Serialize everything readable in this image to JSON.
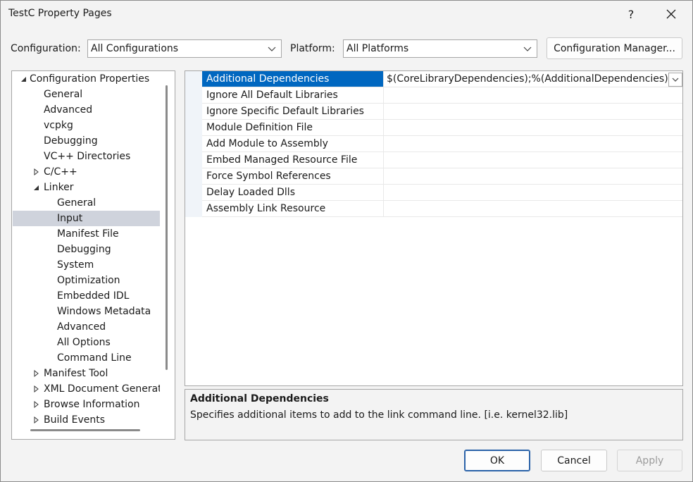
{
  "window": {
    "title": "TestC Property Pages",
    "help_label": "?",
    "close_label": "✕"
  },
  "toolbar": {
    "configuration_label": "Configuration:",
    "configuration_value": "All Configurations",
    "platform_label": "Platform:",
    "platform_value": "All Platforms",
    "config_manager_label": "Configuration Manager..."
  },
  "tree": {
    "items": [
      {
        "label": "Configuration Properties",
        "level": 0,
        "toggle": "expanded"
      },
      {
        "label": "General",
        "level": 1,
        "toggle": "none"
      },
      {
        "label": "Advanced",
        "level": 1,
        "toggle": "none"
      },
      {
        "label": "vcpkg",
        "level": 1,
        "toggle": "none"
      },
      {
        "label": "Debugging",
        "level": 1,
        "toggle": "none"
      },
      {
        "label": "VC++ Directories",
        "level": 1,
        "toggle": "none"
      },
      {
        "label": "C/C++",
        "level": 1,
        "toggle": "collapsed"
      },
      {
        "label": "Linker",
        "level": 1,
        "toggle": "expanded"
      },
      {
        "label": "General",
        "level": 2,
        "toggle": "none"
      },
      {
        "label": "Input",
        "level": 2,
        "toggle": "none",
        "selected": true
      },
      {
        "label": "Manifest File",
        "level": 2,
        "toggle": "none"
      },
      {
        "label": "Debugging",
        "level": 2,
        "toggle": "none"
      },
      {
        "label": "System",
        "level": 2,
        "toggle": "none"
      },
      {
        "label": "Optimization",
        "level": 2,
        "toggle": "none"
      },
      {
        "label": "Embedded IDL",
        "level": 2,
        "toggle": "none"
      },
      {
        "label": "Windows Metadata",
        "level": 2,
        "toggle": "none"
      },
      {
        "label": "Advanced",
        "level": 2,
        "toggle": "none"
      },
      {
        "label": "All Options",
        "level": 2,
        "toggle": "none"
      },
      {
        "label": "Command Line",
        "level": 2,
        "toggle": "none"
      },
      {
        "label": "Manifest Tool",
        "level": 1,
        "toggle": "collapsed"
      },
      {
        "label": "XML Document Generator",
        "level": 1,
        "toggle": "collapsed"
      },
      {
        "label": "Browse Information",
        "level": 1,
        "toggle": "collapsed"
      },
      {
        "label": "Build Events",
        "level": 1,
        "toggle": "collapsed"
      }
    ]
  },
  "properties": {
    "rows": [
      {
        "name": "Additional Dependencies",
        "value": "$(CoreLibraryDependencies);%(AdditionalDependencies)",
        "selected": true
      },
      {
        "name": "Ignore All Default Libraries",
        "value": ""
      },
      {
        "name": "Ignore Specific Default Libraries",
        "value": ""
      },
      {
        "name": "Module Definition File",
        "value": ""
      },
      {
        "name": "Add Module to Assembly",
        "value": ""
      },
      {
        "name": "Embed Managed Resource File",
        "value": ""
      },
      {
        "name": "Force Symbol References",
        "value": ""
      },
      {
        "name": "Delay Loaded Dlls",
        "value": ""
      },
      {
        "name": "Assembly Link Resource",
        "value": ""
      }
    ]
  },
  "description": {
    "title": "Additional Dependencies",
    "text": "Specifies additional items to add to the link command line. [i.e. kernel32.lib]"
  },
  "buttons": {
    "ok_label": "OK",
    "cancel_label": "Cancel",
    "apply_label": "Apply"
  },
  "colors": {
    "selection_blue": "#0067c0",
    "tree_selection": "#cfd3dc"
  }
}
